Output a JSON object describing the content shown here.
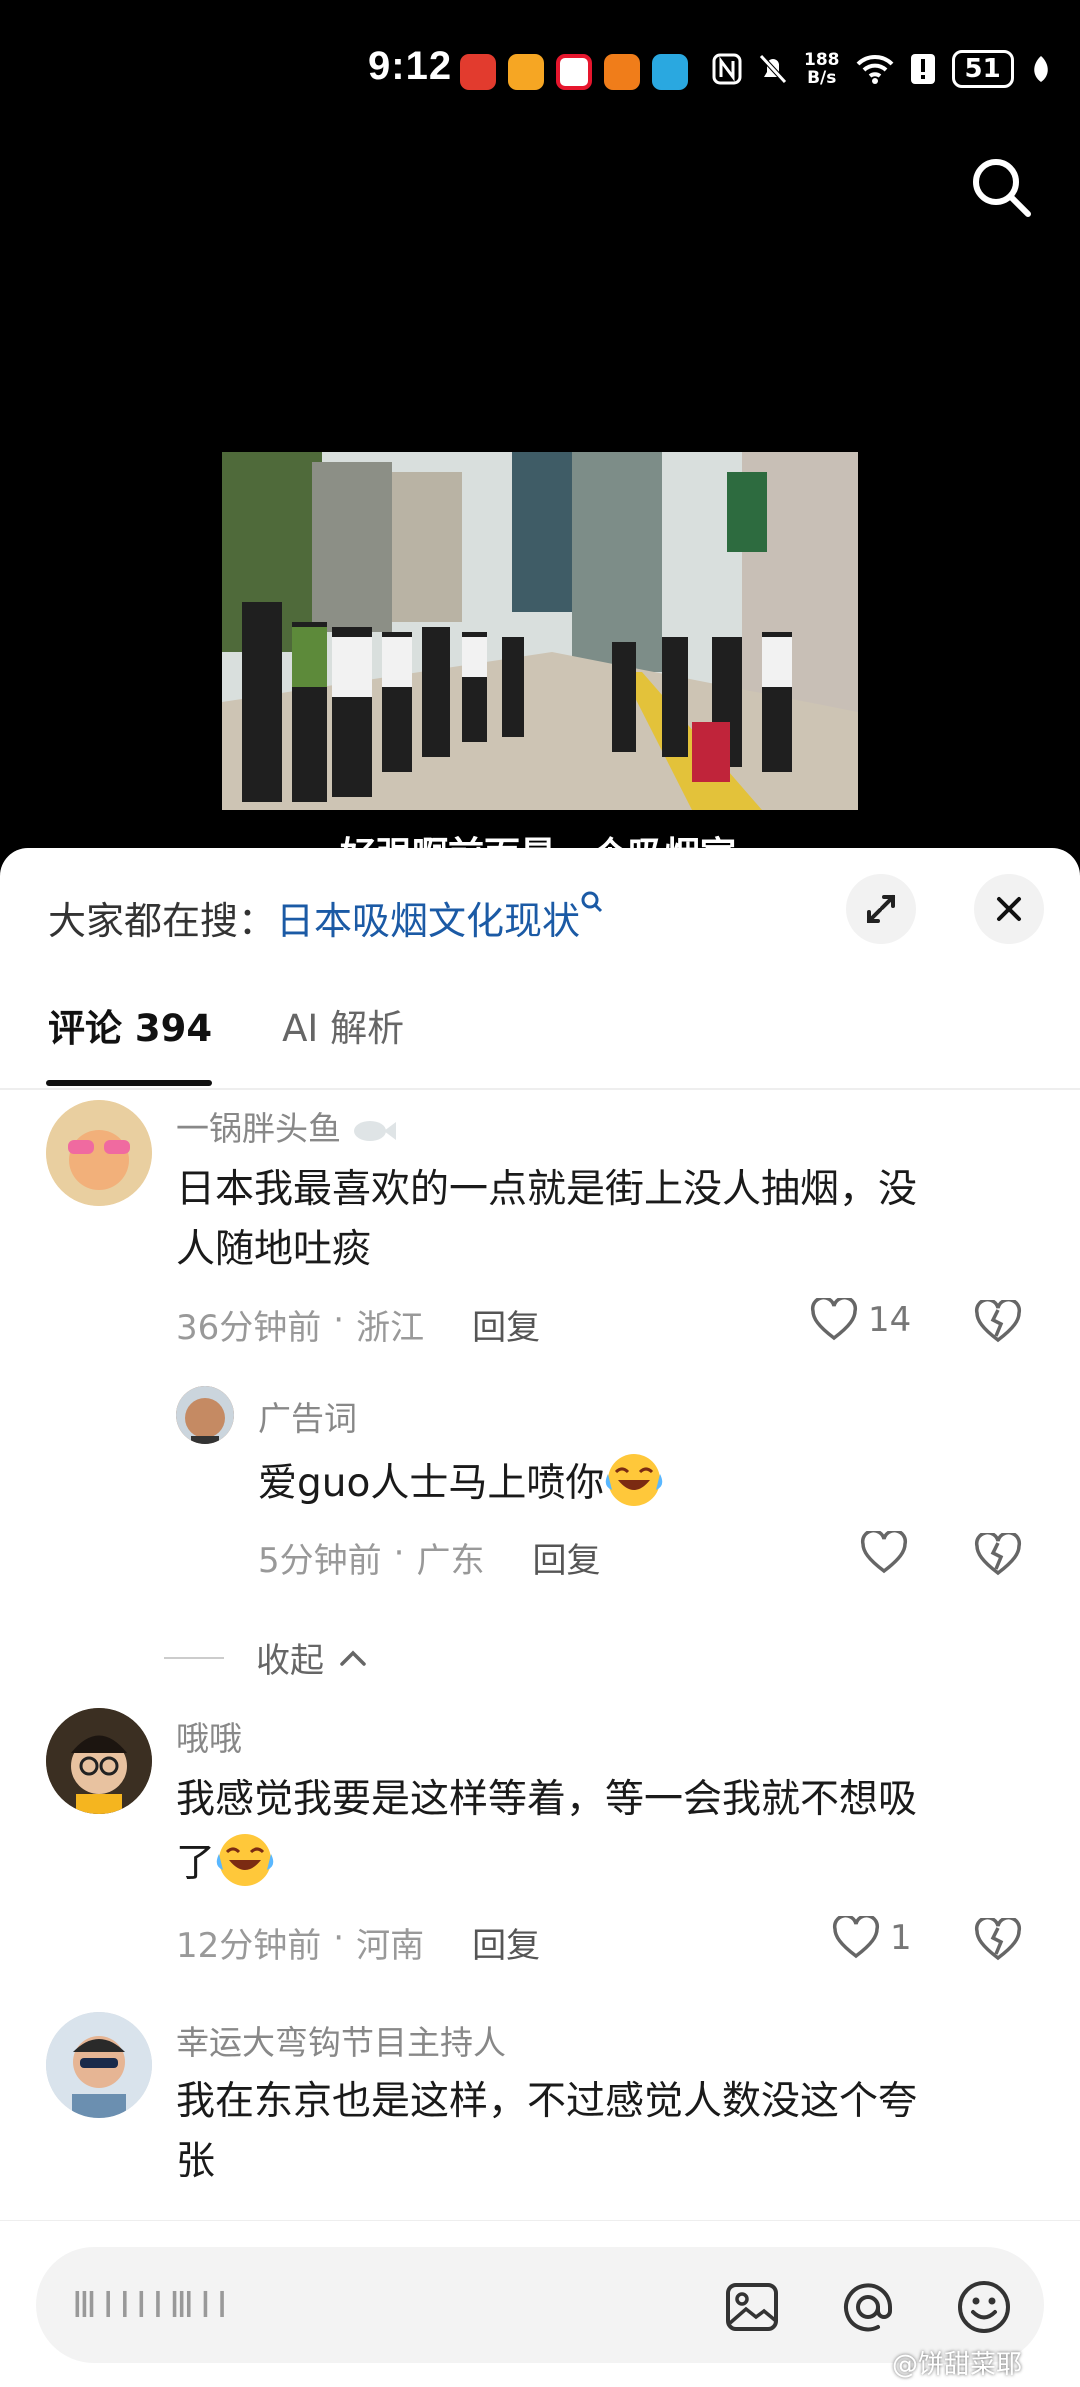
{
  "status_bar": {
    "time": "9:12",
    "net_speed_value": "188",
    "net_speed_unit": "B/s",
    "battery": "51",
    "app_icons": [
      "news-app-icon",
      "weibo-app-icon",
      "weibo-alt-app-icon",
      "video-app-icon",
      "browser-app-icon"
    ],
    "system_icons": [
      "nfc-icon",
      "mute-icon",
      "wifi-icon",
      "alert-icon",
      "leaf-icon"
    ]
  },
  "video": {
    "caption": "好强啊前面是一个吸烟室"
  },
  "comments_panel": {
    "search_prefix": "大家都在搜：",
    "search_term": "日本吸烟文化现状",
    "tabs": [
      {
        "label": "评论 394",
        "active": true
      },
      {
        "label": "AI 解析",
        "active": false
      }
    ],
    "comments": [
      {
        "username": "一锅胖头鱼",
        "text_line1": "日本我最喜欢的一点就是街上没人抽烟，没",
        "text_line2": "人随地吐痰",
        "time": "36分钟前",
        "separator": "·",
        "location": "浙江",
        "reply_label": "回复",
        "likes": "14"
      },
      {
        "username": "广告词",
        "text": "爱guo人士马上喷你",
        "time": "5分钟前",
        "separator": "·",
        "location": "广东",
        "reply_label": "回复",
        "likes": ""
      },
      {
        "username": "哦哦",
        "text_line1": "我感觉我要是这样等着，等一会我就不想吸",
        "text_line2": "了",
        "time": "12分钟前",
        "separator": "·",
        "location": "河南",
        "reply_label": "回复",
        "likes": "1"
      },
      {
        "username": "幸运大弯钩节目主持人",
        "text_line1": "我在东京也是这样，不过感觉人数没这个夸",
        "text_line2": "张"
      }
    ],
    "collapse_label": "收起"
  },
  "input_bar": {
    "placeholder": "ⅢⅠⅠⅠⅠⅢⅠⅠ"
  },
  "watermark": "@饼甜菜耶",
  "colors": {
    "accent_link": "#1b5aa5",
    "meta_gray": "#999999",
    "sheet_bg": "#ffffff"
  }
}
